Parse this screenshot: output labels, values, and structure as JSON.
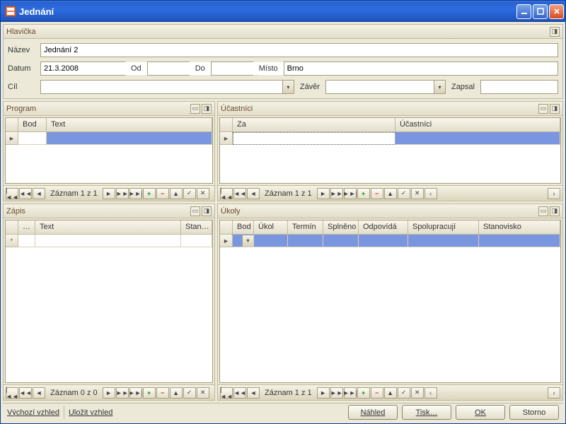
{
  "window": {
    "title": "Jednání"
  },
  "header": {
    "panel_title": "Hlavička",
    "name_label": "Název",
    "name_value": "Jednání 2",
    "date_label": "Datum",
    "date_value": "21.3.2008",
    "from_label": "Od",
    "from_value": "",
    "to_label": "Do",
    "to_value": "",
    "place_label": "Místo",
    "place_value": "Brno",
    "goal_label": "Cíl",
    "goal_value": "",
    "conclusion_label": "Závěr",
    "conclusion_value": "",
    "wrote_label": "Zapsal",
    "wrote_value": ""
  },
  "program": {
    "title": "Program",
    "cols": {
      "bod": "Bod",
      "text": "Text"
    },
    "record": "Záznam 1 z 1"
  },
  "participants": {
    "title": "Účastníci",
    "cols": {
      "za": "Za",
      "ucastnici": "Účastníci"
    },
    "record": "Záznam 1 z 1"
  },
  "zapis": {
    "title": "Zápis",
    "cols": {
      "dots": "…",
      "text": "Text",
      "stan": "Stan…"
    },
    "record": "Záznam 0 z 0"
  },
  "ukoly": {
    "title": "Úkoly",
    "cols": {
      "bod": "Bod",
      "ukol": "Úkol",
      "termin": "Termín",
      "splneno": "Splněno",
      "odpovida": "Odpovídá",
      "spolupracuji": "Spolupracují",
      "stanovisko": "Stanovisko"
    },
    "record": "Záznam 1 z 1"
  },
  "footer": {
    "default_layout": "Výchozí vzhled",
    "save_layout": "Uložit vzhled",
    "preview": "Náhled",
    "print": "Tisk…",
    "ok": "OK",
    "cancel": "Storno"
  },
  "icons": {
    "first": "|◄◄",
    "prevpage": "◄◄",
    "prev": "◄",
    "next": "►",
    "nextpage": "►►",
    "last": "►►|",
    "add": "+",
    "remove": "−",
    "edit": "▲",
    "ok": "✓",
    "cancel": "✕",
    "scroll_left": "‹",
    "scroll_right": "›",
    "pin": "◨",
    "maximize": "▭",
    "dropdown": "▾",
    "spin_up": "▲",
    "spin_down": "▼",
    "row_current": "►",
    "row_new": "*"
  }
}
